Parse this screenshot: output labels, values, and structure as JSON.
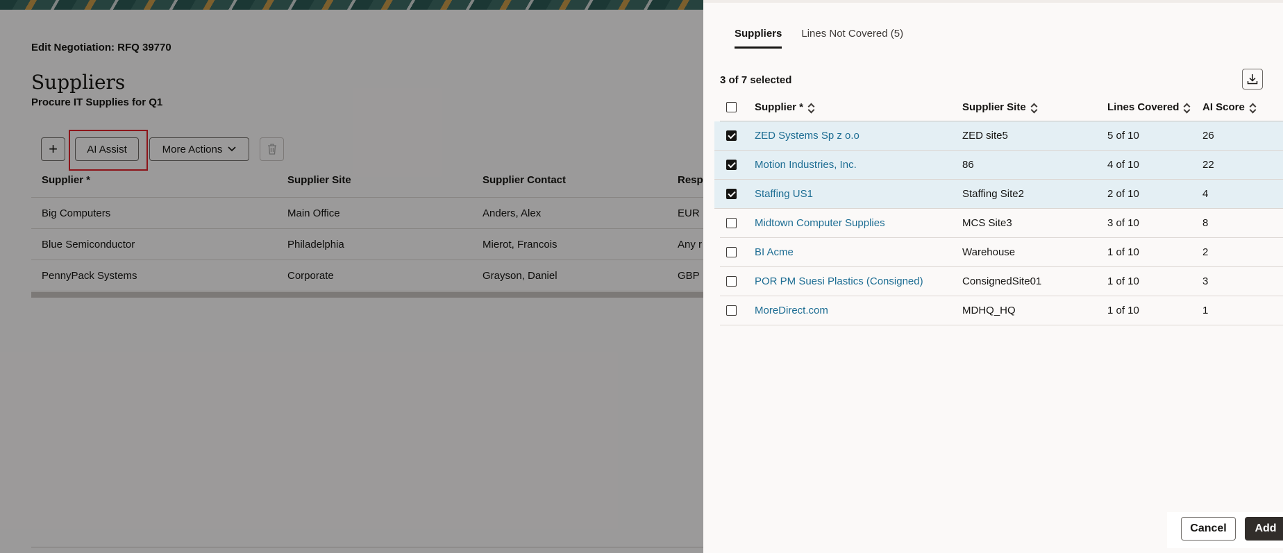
{
  "background": {
    "edit_title": "Edit Negotiation: RFQ 39770",
    "heading": "Suppliers",
    "subtitle": "Procure IT Supplies for Q1",
    "toolbar": {
      "add_label": "+",
      "ai_assist_label": "AI Assist",
      "more_actions_label": "More Actions"
    },
    "table": {
      "columns": [
        "Supplier *",
        "Supplier Site",
        "Supplier Contact",
        "Respo"
      ],
      "rows": [
        [
          "Big Computers",
          "Main Office",
          "Anders, Alex",
          "EUR"
        ],
        [
          "Blue Semiconductor",
          "Philadelphia",
          "Mierot, Francois",
          "Any r"
        ],
        [
          "PennyPack Systems",
          "Corporate",
          "Grayson, Daniel",
          "GBP"
        ]
      ]
    }
  },
  "drawer": {
    "tabs": [
      {
        "label": "Suppliers",
        "active": true
      },
      {
        "label": "Lines Not Covered (5)",
        "active": false
      }
    ],
    "selected_count": "3 of 7 selected",
    "columns": [
      "Supplier *",
      "Supplier Site",
      "Lines Covered",
      "AI Score"
    ],
    "rows": [
      {
        "supplier": "ZED Systems Sp z o.o",
        "site": "ZED site5",
        "lines": "5 of 10",
        "score": "26",
        "selected": true
      },
      {
        "supplier": "Motion Industries, Inc.",
        "site": "86",
        "lines": "4 of 10",
        "score": "22",
        "selected": true
      },
      {
        "supplier": "Staffing US1",
        "site": "Staffing Site2",
        "lines": "2 of 10",
        "score": "4",
        "selected": true
      },
      {
        "supplier": "Midtown Computer Supplies",
        "site": "MCS Site3",
        "lines": "3 of 10",
        "score": "8",
        "selected": false
      },
      {
        "supplier": "BI Acme",
        "site": "Warehouse",
        "lines": "1 of 10",
        "score": "2",
        "selected": false
      },
      {
        "supplier": "POR PM Suesi Plastics (Consigned)",
        "site": "ConsignedSite01",
        "lines": "1 of 10",
        "score": "3",
        "selected": false
      },
      {
        "supplier": "MoreDirect.com",
        "site": "MDHQ_HQ",
        "lines": "1 of 10",
        "score": "1",
        "selected": false
      }
    ],
    "footer": {
      "cancel_label": "Cancel",
      "add_label": "Add"
    }
  },
  "colors": {
    "link": "#1d6d93",
    "selected_row": "#e4eff4",
    "highlight": "#e3222b",
    "primary_button": "#312d2a"
  }
}
